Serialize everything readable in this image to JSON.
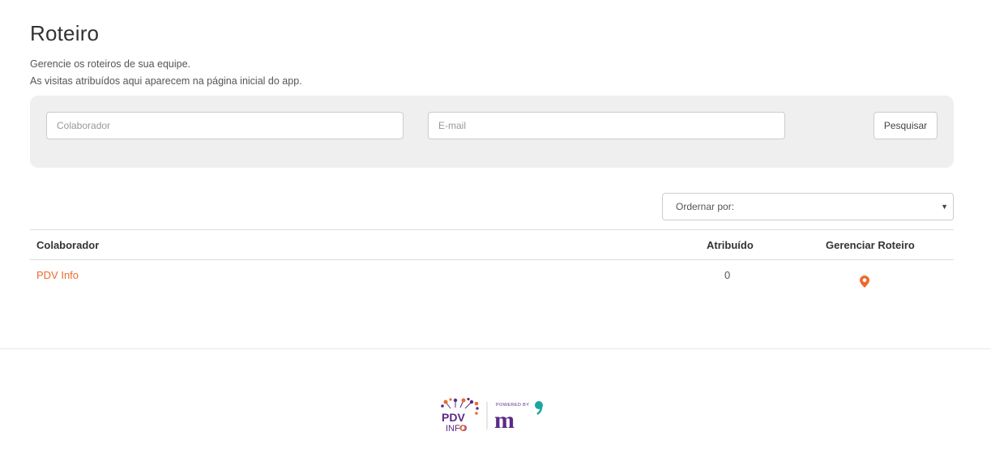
{
  "page": {
    "title": "Roteiro",
    "description_line1": "Gerencie os roteiros de sua equipe.",
    "description_line2": "As visitas atribuídos aqui aparecem na página inicial do app."
  },
  "search": {
    "collaborator_placeholder": "Colaborador",
    "email_placeholder": "E-mail",
    "button_label": "Pesquisar"
  },
  "sort": {
    "label": "Ordernar por:",
    "caret": "▼"
  },
  "table": {
    "headers": [
      "Colaborador",
      "Atribuído",
      "Gerenciar Roteiro"
    ],
    "rows": [
      {
        "collaborator": "PDV Info",
        "assigned": "0",
        "action_icon": "map-pin-icon"
      }
    ]
  },
  "footer": {
    "logo_left_text_top": "PDV",
    "logo_left_text_bottom": "INFO",
    "powered_by": "POWERED BY",
    "logo_right_text": "m"
  },
  "colors": {
    "accent": "#ee6a2c",
    "panel_bg": "#efefef",
    "brand_purple": "#5b2a86",
    "brand_teal": "#1aa6a0"
  }
}
